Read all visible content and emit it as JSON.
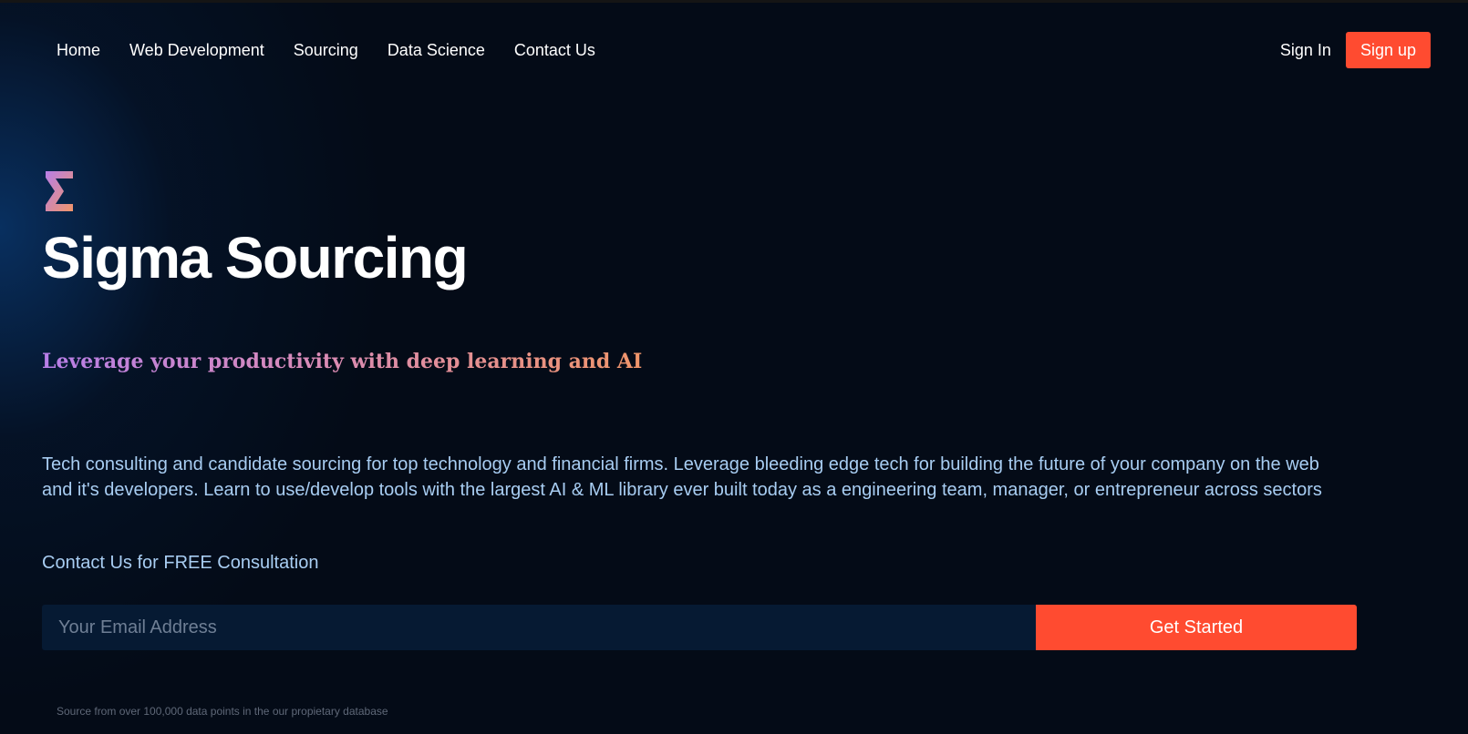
{
  "nav": {
    "links": [
      "Home",
      "Web Development",
      "Sourcing",
      "Data Science",
      "Contact Us"
    ],
    "sign_in": "Sign In",
    "sign_up": "Sign up"
  },
  "hero": {
    "logo_icon": "sigma-icon",
    "title": "Sigma Sourcing",
    "tagline": "Leverage your productivity with deep learning and AI",
    "description": "Tech consulting and candidate sourcing for top technology and financial firms. Leverage bleeding edge tech for building the future of your company on the web and it's developers. Learn to use/develop tools with the largest AI & ML library ever built today as a engineering team, manager, or entrepreneur across sectors",
    "cta_text": "Contact Us for FREE Consultation"
  },
  "form": {
    "email_placeholder": "Your Email Address",
    "submit_label": "Get Started"
  },
  "footnote": "Source from over 100,000 data points in the our propietary database",
  "colors": {
    "accent": "#ff4b30",
    "background": "#040b17",
    "body_text": "#a8cdf2",
    "input_bg": "#061a33"
  }
}
